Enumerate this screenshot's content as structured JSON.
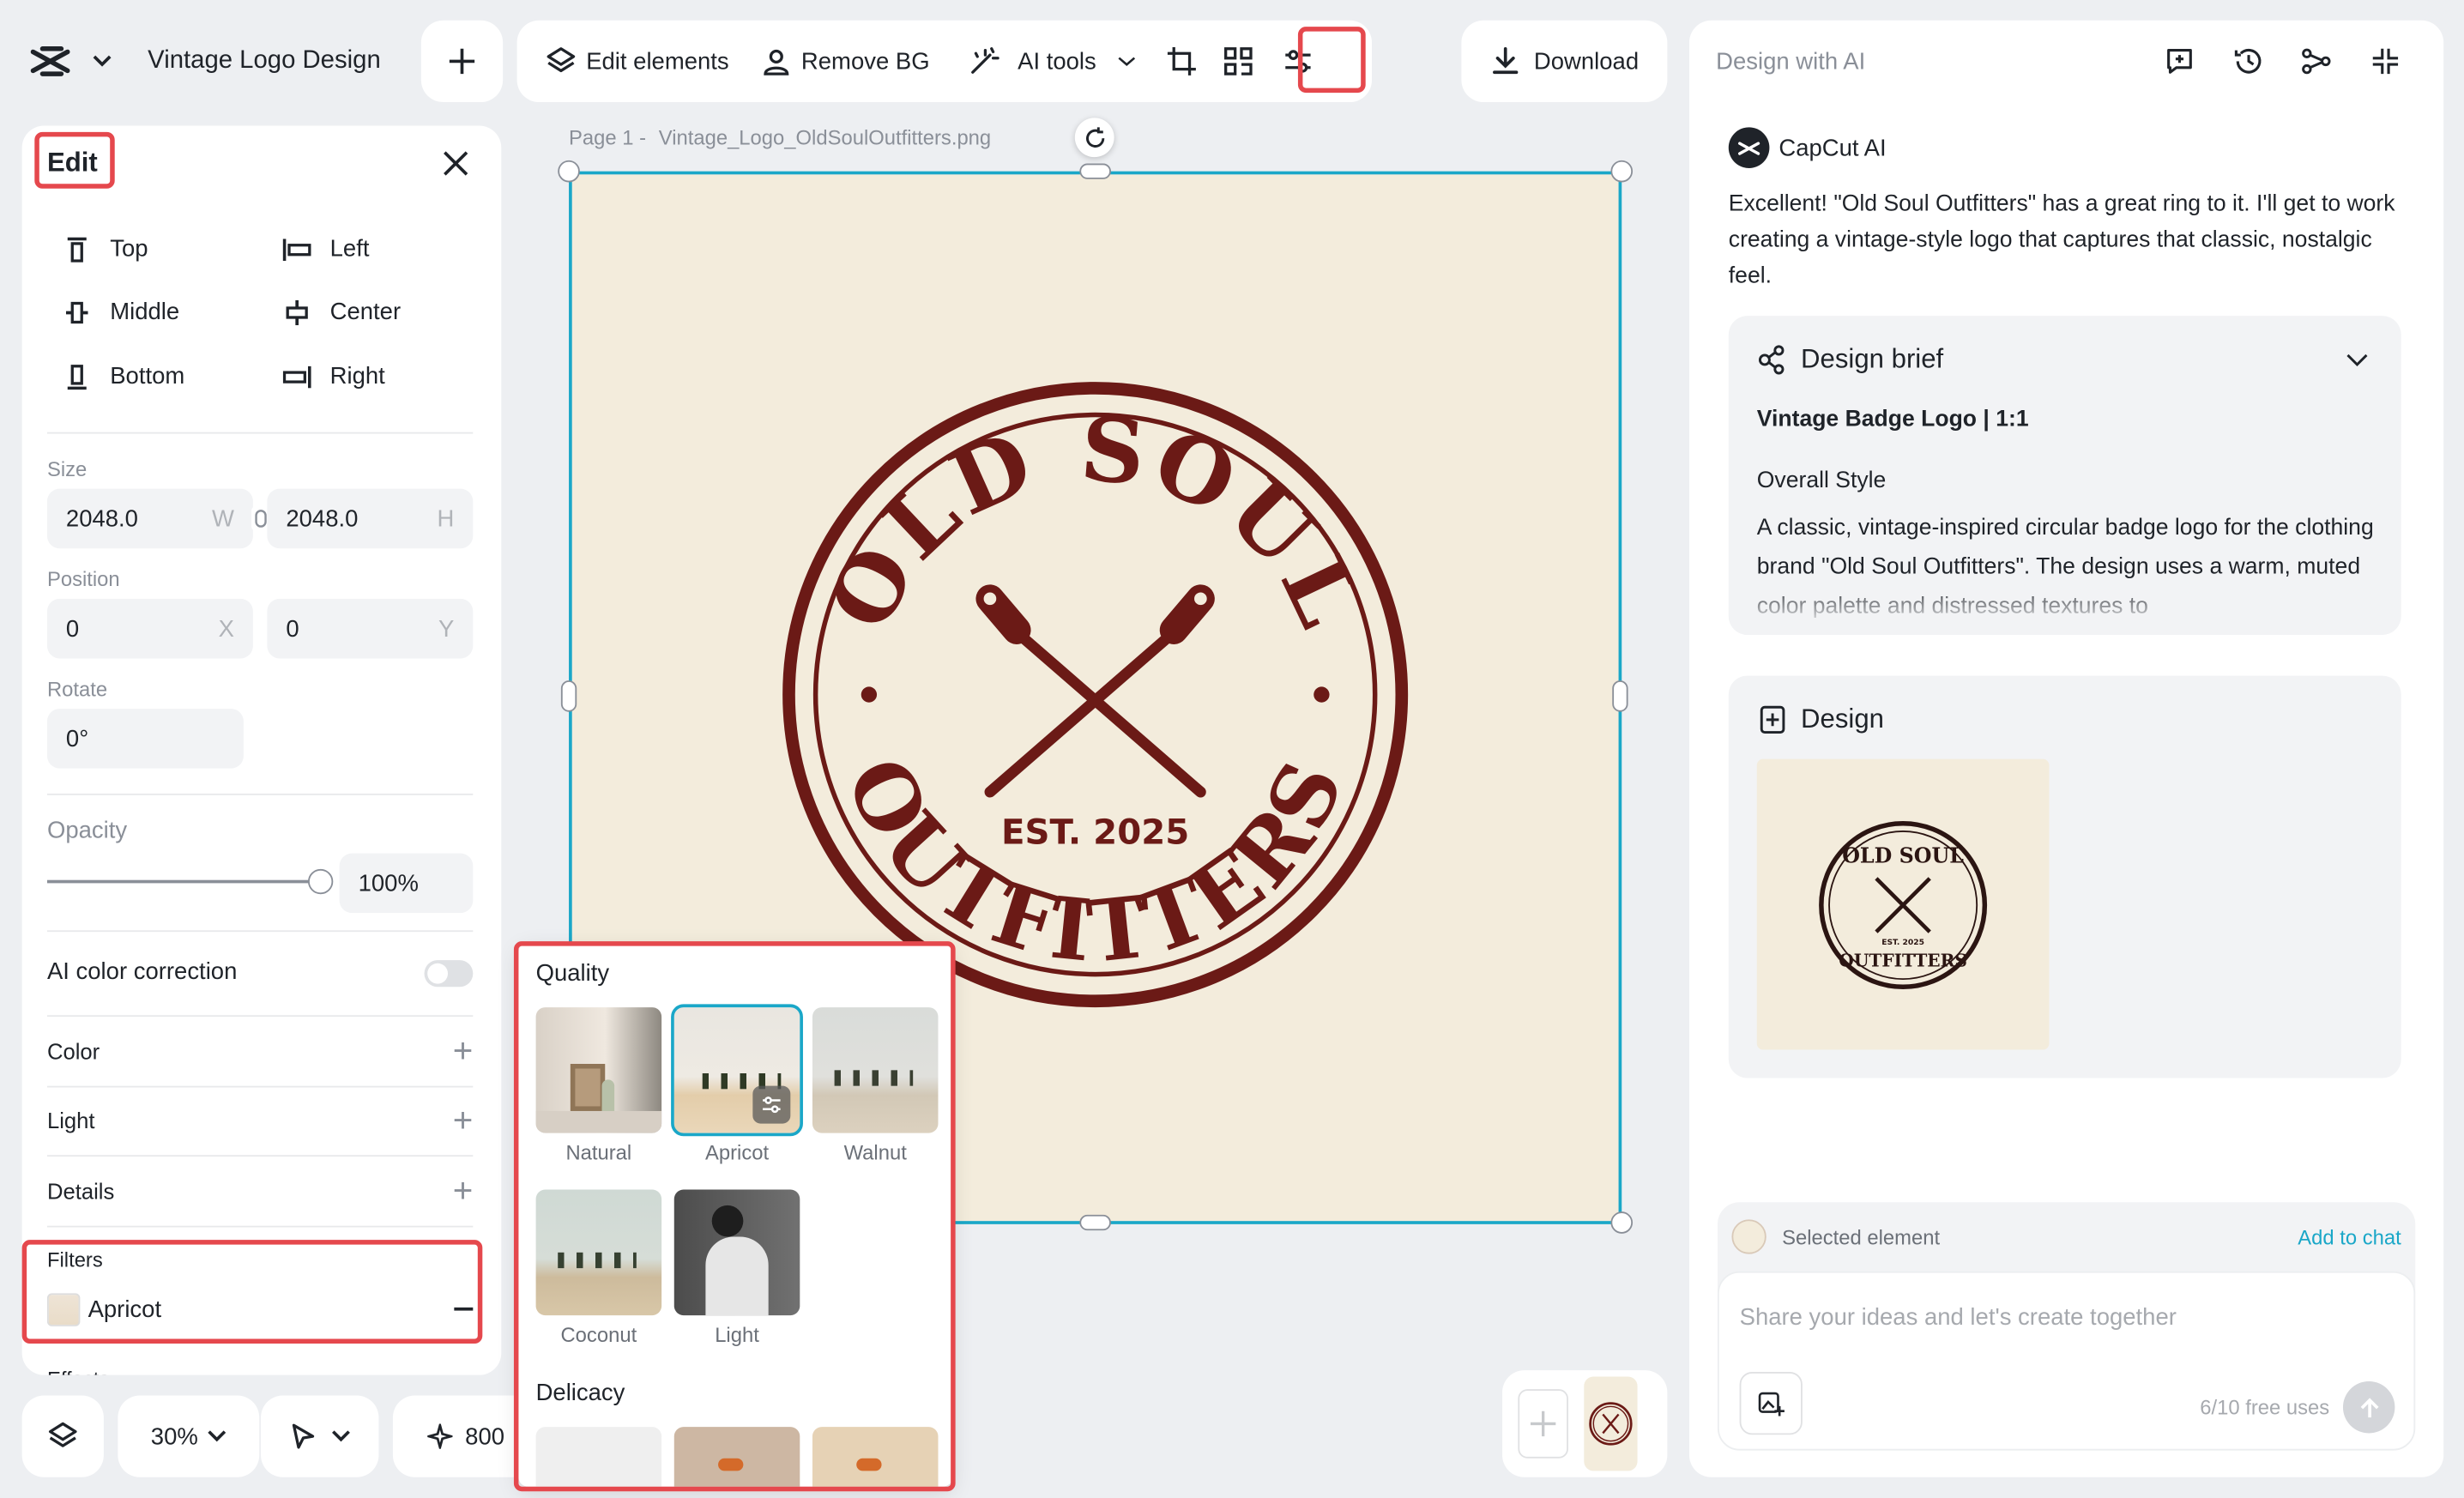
{
  "header": {
    "title": "Vintage Logo Design",
    "add_label": "+"
  },
  "toolbar": {
    "edit_elements": "Edit elements",
    "remove_bg": "Remove BG",
    "ai_tools": "AI tools",
    "download": "Download"
  },
  "edit_panel": {
    "title": "Edit",
    "align": {
      "top": "Top",
      "left": "Left",
      "middle": "Middle",
      "center": "Center",
      "bottom": "Bottom",
      "right": "Right"
    },
    "size_label": "Size",
    "width": "2048.0",
    "width_suffix": "W",
    "height": "2048.0",
    "height_suffix": "H",
    "position_label": "Position",
    "pos_x": "0",
    "pos_x_suffix": "X",
    "pos_y": "0",
    "pos_y_suffix": "Y",
    "rotate_label": "Rotate",
    "rotate": "0°",
    "opacity_label": "Opacity",
    "opacity": "100%",
    "opacity_value": 1.0,
    "ai_color_correction": "AI color correction",
    "color": "Color",
    "light": "Light",
    "details": "Details",
    "filters_label": "Filters",
    "filter_value": "Apricot",
    "effects_partial": "Effects"
  },
  "bottom_bar": {
    "zoom": "30%",
    "credits": "800"
  },
  "canvas": {
    "page_label": "Page 1 -",
    "file_name": "Vintage_Logo_OldSoulOutfitters.png"
  },
  "logo": {
    "top_text": "OLD SOUL",
    "bottom_text": "OUTFITTERS",
    "est": "EST. 2025",
    "color": "#6b1a16",
    "bg": "#f3ecdc"
  },
  "filters_popup": {
    "quality_title": "Quality",
    "quality": [
      {
        "name": "Natural",
        "selected": false
      },
      {
        "name": "Apricot",
        "selected": true
      },
      {
        "name": "Walnut",
        "selected": false
      },
      {
        "name": "Coconut",
        "selected": false
      },
      {
        "name": "Light",
        "selected": false
      }
    ],
    "delicacy_title": "Delicacy"
  },
  "ai_panel": {
    "title": "Design with AI",
    "assistant_name": "CapCut AI",
    "message": "Excellent! \"Old Soul Outfitters\" has a great ring to it. I'll get to work creating a vintage-style logo that captures that classic, nostalgic feel.",
    "brief": {
      "title": "Design brief",
      "subtitle": "Vintage Badge Logo | 1:1",
      "section": "Overall Style",
      "body": "A classic, vintage-inspired circular badge logo for the clothing brand \"Old Soul Outfitters\". The design uses a warm, muted color palette and distressed textures to"
    },
    "design_title": "Design",
    "selected_element": "Selected element",
    "add_to_chat": "Add to chat",
    "input_placeholder": "Share your ideas and let's create together",
    "free_uses": "6/10 free uses"
  },
  "colors": {
    "accent": "#1aa7c8",
    "highlight": "#e5484d",
    "link": "#1aa7c8"
  }
}
